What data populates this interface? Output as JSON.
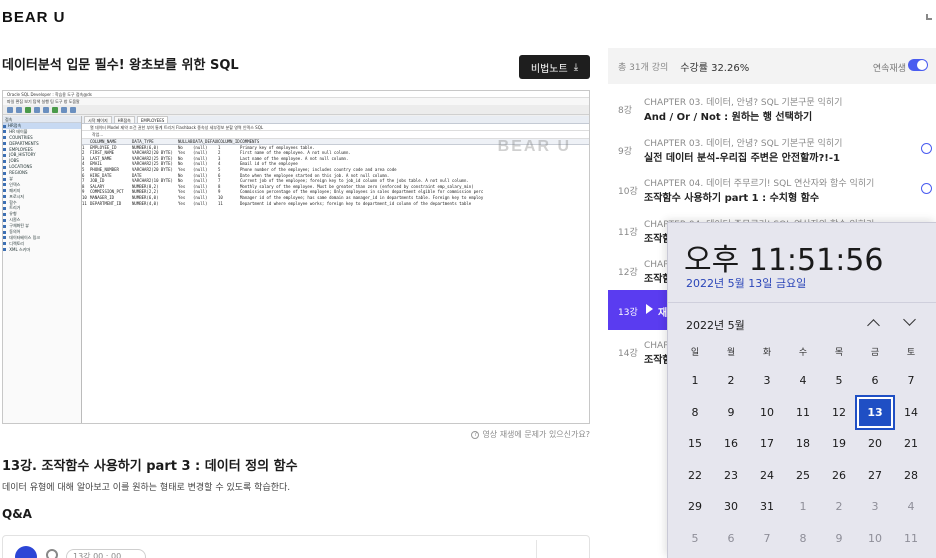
{
  "header": {
    "logo": "BEAR U"
  },
  "course": {
    "title": "데이터분석 입문 필수! 왕초보를 위한 SQL",
    "note_button": "비법노트",
    "download_icon": "download-icon"
  },
  "video": {
    "watermark": "BEAR U",
    "app_title": "Oracle SQL Developer : 학습용 도구 접속@ds",
    "menu": "파일 편집 보기 탐색 실행 팀 도구 창 도움말",
    "panel_header": "접속",
    "tree": [
      "HR접속",
      "  HR 테이블",
      "  COUNTRIES",
      "  DEPARTMENTS",
      "  EMPLOYEES",
      "  JOB_HISTORY",
      "  JOBS",
      "  LOCATIONS",
      "  REGIONS",
      "  뷰",
      "  인덱스",
      "  패키지",
      "  프로시저",
      "  함수",
      "  트리거",
      "  유형",
      "  시퀀스",
      "  구체화된 뷰",
      "  동의어",
      "  데이터베이스 링크",
      "  디렉토리",
      "  XML 스키마"
    ],
    "tabs": [
      "시작 페이지",
      "HR접속",
      "EMPLOYEES"
    ],
    "subtabs": "열 데이터 Model 제약 조건 권한 부여 통계 트리거 Flashback 종속성 세부정보 분할 영역 인덱스 SQL",
    "actions": "작업...",
    "grid_headers": [
      "",
      "COLUMN_NAME",
      "DATA_TYPE",
      "NULLABLE",
      "DATA_DEFAULT",
      "COLUMN_ID",
      "COMMENTS"
    ],
    "grid_rows": [
      [
        "1",
        "EMPLOYEE_ID",
        "NUMBER(6,0)",
        "No",
        "(null)",
        "1",
        "Primary key of employees table."
      ],
      [
        "2",
        "FIRST_NAME",
        "VARCHAR2(20 BYTE)",
        "Yes",
        "(null)",
        "2",
        "First name of the employee. A not null column."
      ],
      [
        "3",
        "LAST_NAME",
        "VARCHAR2(25 BYTE)",
        "No",
        "(null)",
        "3",
        "Last name of the employee. A not null column."
      ],
      [
        "4",
        "EMAIL",
        "VARCHAR2(25 BYTE)",
        "No",
        "(null)",
        "4",
        "Email id of the employee"
      ],
      [
        "5",
        "PHONE_NUMBER",
        "VARCHAR2(20 BYTE)",
        "Yes",
        "(null)",
        "5",
        "Phone number of the employee; includes country code and area code"
      ],
      [
        "6",
        "HIRE_DATE",
        "DATE",
        "No",
        "(null)",
        "6",
        "Date when the employee started on this job. A not null column."
      ],
      [
        "7",
        "JOB_ID",
        "VARCHAR2(10 BYTE)",
        "No",
        "(null)",
        "7",
        "Current job of the employee; foreign key to job_id column of the jobs table. A not null column."
      ],
      [
        "8",
        "SALARY",
        "NUMBER(8,2)",
        "Yes",
        "(null)",
        "8",
        "Monthly salary of the employee. Must be greater than zero (enforced by constraint emp_salary_min)"
      ],
      [
        "9",
        "COMMISSION_PCT",
        "NUMBER(2,2)",
        "Yes",
        "(null)",
        "9",
        "Commission percentage of the employee; Only employees in sales department elgible for commission perc"
      ],
      [
        "10",
        "MANAGER_ID",
        "NUMBER(6,0)",
        "Yes",
        "(null)",
        "10",
        "Manager id of the employee; has same domain as manager_id in departments table. Foreign key to employ"
      ],
      [
        "11",
        "DEPARTMENT_ID",
        "NUMBER(4,0)",
        "Yes",
        "(null)",
        "11",
        "Department id where employee works; foreign key to department_id column of the departments table"
      ]
    ]
  },
  "report_issue": "영상 재생에 문제가 있으신가요?",
  "lesson": {
    "title": "13강. 조작함수 사용하기 part 3 : 데이터 정의 함수",
    "description": "데이터 유형에 대해 알아보고 이를 원하는 형태로 변경할 수 있도록 학습한다."
  },
  "qa": {
    "title": "Q&A",
    "chip": "13강 00 : 00"
  },
  "sidebar": {
    "total": "총 31개 강의",
    "progress": "수강률 32.26%",
    "autoplay": "연속재생",
    "lessons": [
      {
        "num": "8강",
        "chapter": "CHAPTER 03. 데이터, 안녕? SQL 기본구문 익히기",
        "title": "And / Or / Not : 원하는 행 선택하기",
        "done": false
      },
      {
        "num": "9강",
        "chapter": "CHAPTER 03. 데이터, 안녕? SQL 기본구문 익히기",
        "title": "실전 데이터 분석-우리집 주변은 안전할까?!-1",
        "done": true
      },
      {
        "num": "10강",
        "chapter": "CHAPTER 04. 데이터 주무르기! SQL 연산자와 함수 익히기",
        "title": "조작함수 사용하기 part 1 : 수치형 함수",
        "done": true
      },
      {
        "num": "11강",
        "chapter": "CHAPTER 04. 데이터 주무르기! SQL 연산자와 함수 익히기",
        "title": "조작함수 사용하기 part 2 : 문자형 함수",
        "done": false
      },
      {
        "num": "12강",
        "chapter": "CHAPTER 04. 데이터 주무르기! SQL 연산자와 함수 익히기",
        "title": "조작함수 사용하기 part 3 : 날짜형 함수",
        "done": false
      },
      {
        "num": "13강",
        "chapter": "",
        "title": "재생 중",
        "done": false
      },
      {
        "num": "14강",
        "chapter": "CHAPTER 04. 데이터 주무르기! SQL 연산자와 함수 익히기",
        "title": "조작함수 사용하기 part 4",
        "done": false
      }
    ]
  },
  "clock": {
    "time": "오후 11:51:56",
    "date": "2022년 5월 13일 금요일",
    "month": "2022년 5월",
    "weekdays": [
      "일",
      "월",
      "화",
      "수",
      "목",
      "금",
      "토"
    ],
    "weeks": [
      [
        "1",
        "2",
        "3",
        "4",
        "5",
        "6",
        "7"
      ],
      [
        "8",
        "9",
        "10",
        "11",
        "12",
        "13",
        "14"
      ],
      [
        "15",
        "16",
        "17",
        "18",
        "19",
        "20",
        "21"
      ],
      [
        "22",
        "23",
        "24",
        "25",
        "26",
        "27",
        "28"
      ],
      [
        "29",
        "30",
        "31",
        "1",
        "2",
        "3",
        "4"
      ],
      [
        "5",
        "6",
        "7",
        "8",
        "9",
        "10",
        "11"
      ]
    ],
    "today": "13",
    "accent": "#1f4fc4"
  }
}
